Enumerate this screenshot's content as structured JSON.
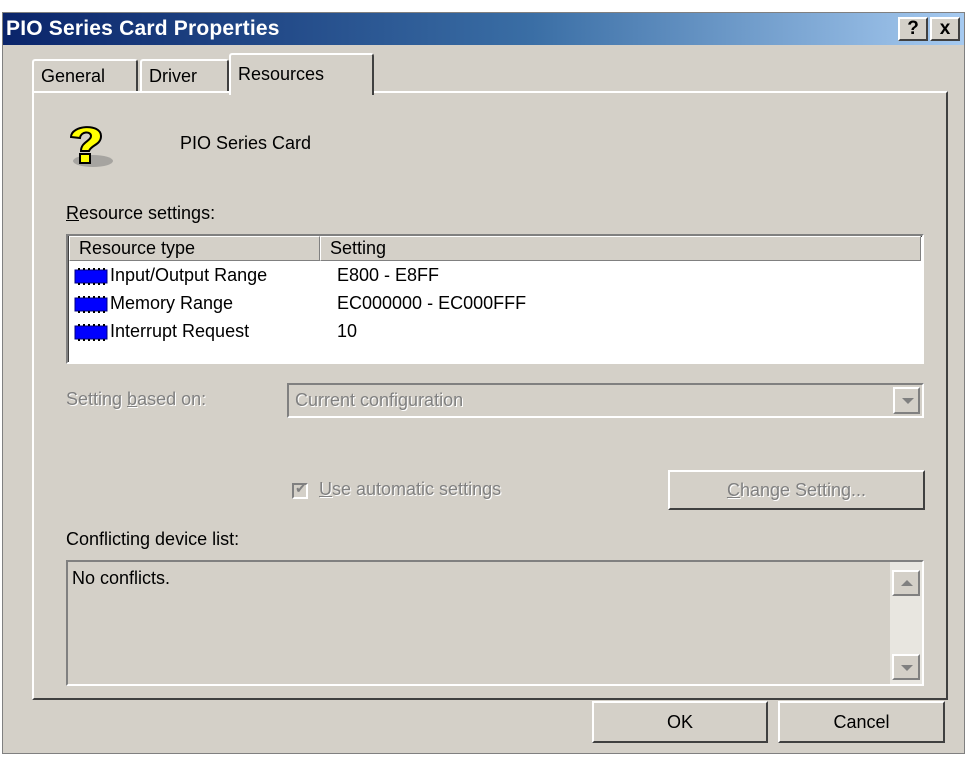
{
  "window": {
    "title": "PIO Series Card Properties",
    "help_label": "?",
    "close_label": "x",
    "title_gradient_start": "#0a246a",
    "title_gradient_end": "#a6caf0"
  },
  "tabs": [
    {
      "label": "General",
      "selected": false
    },
    {
      "label": "Driver",
      "selected": false
    },
    {
      "label": "Resources",
      "selected": true
    }
  ],
  "device": {
    "icon": "unknown-device-question-icon",
    "name": "PIO Series Card"
  },
  "resource_settings": {
    "label_accel": "R",
    "label_rest": "esource settings:",
    "columns": [
      "Resource type",
      "Setting"
    ],
    "rows": [
      {
        "icon": "chip-icon",
        "type": "Input/Output Range",
        "setting": "E800 - E8FF"
      },
      {
        "icon": "chip-icon",
        "type": "Memory Range",
        "setting": "EC000000 - EC000FFF"
      },
      {
        "icon": "chip-icon",
        "type": "Interrupt Request",
        "setting": "10"
      }
    ]
  },
  "setting_based_on": {
    "label_pre": "Setting ",
    "label_accel": "b",
    "label_post": "ased on:",
    "value": "Current configuration",
    "enabled": false
  },
  "auto_settings": {
    "label_accel": "U",
    "label_rest": "se automatic settings",
    "checked": true,
    "enabled": false
  },
  "change_setting": {
    "label_accel": "C",
    "label_rest": "hange Setting...",
    "enabled": false
  },
  "conflicts": {
    "label": "Conflicting device list:",
    "text": "No conflicts."
  },
  "buttons": {
    "ok": "OK",
    "cancel": "Cancel"
  }
}
